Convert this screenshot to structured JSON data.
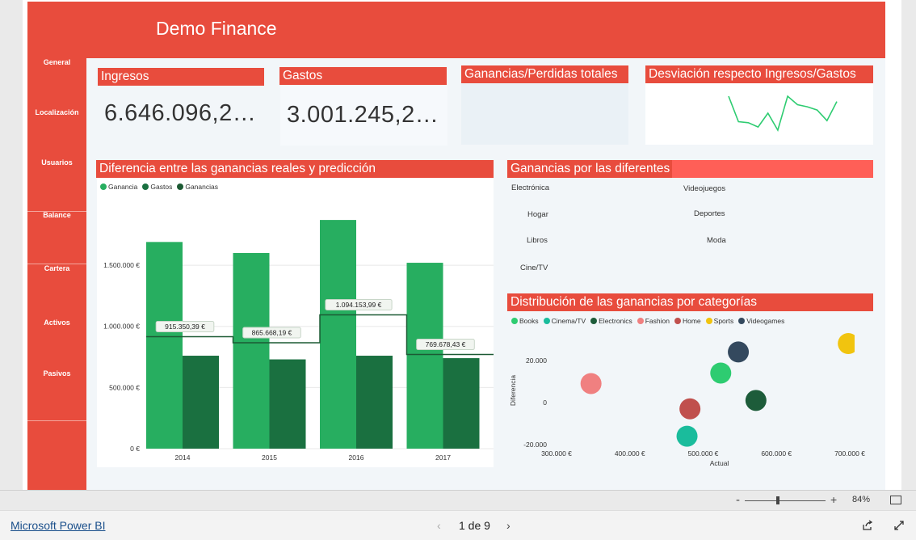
{
  "header": {
    "title": "Demo Finance"
  },
  "nav": {
    "items": [
      {
        "label": "General"
      },
      {
        "label": "Localización"
      },
      {
        "label": "Usuarios"
      },
      {
        "label": "Balance"
      },
      {
        "label": "Cartera"
      },
      {
        "label": "Activos"
      },
      {
        "label": "Pasivos"
      }
    ]
  },
  "kpis": {
    "ingresos": {
      "title": "Ingresos",
      "value": "6.646.096,2…"
    },
    "gastos": {
      "title": "Gastos",
      "value": "3.001.245,2…"
    },
    "ganancias": {
      "title": "Ganancias/Perdidas totales"
    },
    "desviacion": {
      "title": "Desviación respecto Ingresos/Gastos"
    }
  },
  "colors": {
    "accent": "#e84c3d",
    "accent_light": "#ff5f57",
    "bar_green": "#27ae60",
    "bar_dark": "#1a7040",
    "step_line": "#1c5a34",
    "spark": "#2ecc71"
  },
  "diff_panel": {
    "title": "Diferencia entre las ganancias reales y predicción"
  },
  "categories_panel": {
    "title": "Ganancias por las diferentes categorías",
    "items_left": [
      "Electrónica",
      "Hogar",
      "Libros",
      "Cine/TV"
    ],
    "items_right": [
      "Videojuegos",
      "Deportes",
      "Moda"
    ]
  },
  "scatter_panel": {
    "title": "Distribución de las ganancias por categorías"
  },
  "chart_data": [
    {
      "type": "bar",
      "categories": [
        "2014",
        "2015",
        "2016",
        "2017"
      ],
      "series": [
        {
          "name": "Ganancia",
          "values": [
            1690000,
            1600000,
            1870000,
            1520000
          ],
          "color": "#27ae60"
        },
        {
          "name": "Gastos",
          "values": [
            760000,
            730000,
            760000,
            740000
          ],
          "color": "#1a7040"
        },
        {
          "name": "Ganancias",
          "values": [
            915350.39,
            865668.19,
            1094153.99,
            769678.43
          ],
          "color": "#1c5a34",
          "style": "step-line"
        }
      ],
      "data_labels": [
        "915.350,39 €",
        "865.668,19 €",
        "1.094.153,99 €",
        "769.678,43 €"
      ],
      "ytick_labels": [
        "0 €",
        "500.000 €",
        "1.000.000 €",
        "1.500.000 €"
      ],
      "yticks": [
        0,
        500000,
        1000000,
        1500000
      ],
      "ylim": [
        0,
        1950000
      ],
      "legend": "top-left",
      "grid": true
    },
    {
      "type": "scatter",
      "xlabel": "Actual",
      "ylabel": "Diferencia",
      "xlim": [
        300000,
        700000
      ],
      "ylim": [
        -20000,
        28000
      ],
      "xticks": [
        300000,
        400000,
        500000,
        600000,
        700000
      ],
      "xtick_labels": [
        "300.000 €",
        "400.000 €",
        "500.000 €",
        "600.000 €",
        "700.000 €"
      ],
      "yticks": [
        20000,
        0,
        -20000
      ],
      "ytick_labels": [
        "20.000",
        "0",
        "-20.000"
      ],
      "legend": "top-left",
      "series": [
        {
          "name": "Books",
          "x": 524000,
          "y": 14000,
          "color": "#2ecc71"
        },
        {
          "name": "Cinema/TV",
          "x": 478000,
          "y": -16000,
          "color": "#1abc9c"
        },
        {
          "name": "Electronics",
          "x": 572000,
          "y": 1000,
          "color": "#1d5c3a"
        },
        {
          "name": "Fashion",
          "x": 347000,
          "y": 9000,
          "color": "#f08080"
        },
        {
          "name": "Home",
          "x": 482000,
          "y": -3000,
          "color": "#c0504d"
        },
        {
          "name": "Sports",
          "x": 698000,
          "y": 28000,
          "color": "#f1c40f"
        },
        {
          "name": "Videogames",
          "x": 548000,
          "y": 24000,
          "color": "#34495e"
        }
      ]
    },
    {
      "type": "line",
      "values": [
        44,
        68,
        69,
        73,
        60,
        76,
        44,
        52,
        54,
        57,
        67,
        49
      ],
      "color": "#2ecc71"
    }
  ],
  "statusbar": {
    "zoom": "84%",
    "minus": "-",
    "plus": "+"
  },
  "footer": {
    "brand": "Microsoft Power BI",
    "pager": "1 de 9"
  }
}
